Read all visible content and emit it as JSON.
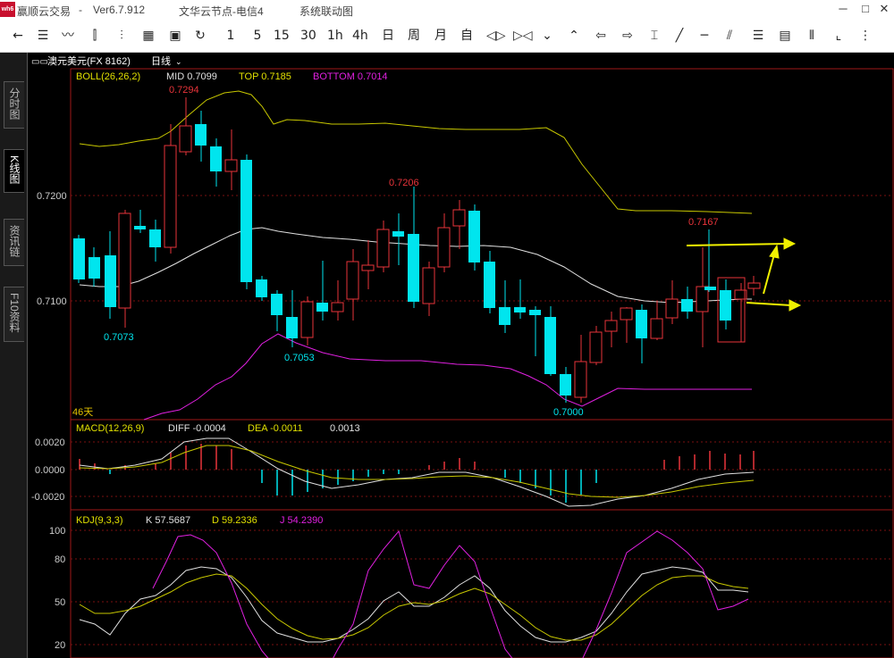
{
  "titlebar": {
    "app_name": "赢顺云交易",
    "separator": "-",
    "version": "Ver6.7.912",
    "node": "文华云节点-电信4",
    "sys": "系统联动图",
    "logo": "wh6"
  },
  "toolbar": {
    "periods": [
      "1",
      "5",
      "15",
      "30",
      "1h",
      "4h",
      "日",
      "周",
      "月",
      "自"
    ]
  },
  "sidetabs": [
    {
      "label": "分时图",
      "active": false
    },
    {
      "label": "K线图",
      "active": true
    },
    {
      "label": "资讯链",
      "active": false
    },
    {
      "label": "F10资料",
      "active": false
    }
  ],
  "header": {
    "menu_glyph": "▭▭",
    "symbol": "澳元美元(FX 8162)",
    "period": "日线"
  },
  "boll": {
    "name": "BOLL(26,26,2)",
    "mid": "MID 0.7099",
    "top": "TOP 0.7185",
    "bottom": "BOTTOM 0.7014"
  },
  "macd": {
    "name": "MACD(12,26,9)",
    "diff": "DIFF -0.0004",
    "dea": "DEA -0.0011",
    "macd": "0.0013"
  },
  "kdj": {
    "name": "KDJ(9,3,3)",
    "k": "K 57.5687",
    "d": "D 59.2336",
    "j": "J 54.2390"
  },
  "days_label": "46天",
  "price_axis": [
    "0.7200",
    "0.7100"
  ],
  "macd_axis": [
    "0.0020",
    "0.0000",
    "-0.0020"
  ],
  "kdj_axis": [
    "100",
    "80",
    "50",
    "20"
  ],
  "annotations": {
    "high1": "0.7294",
    "high2": "0.7206",
    "high3": "0.7167",
    "low1": "0.7073",
    "low2": "0.7053",
    "low3": "0.7000"
  },
  "colors": {
    "up": "#e8343a",
    "down": "#00e5ee",
    "boll_mid": "#e0e0e0",
    "boll_top": "#c8c800",
    "boll_bottom": "#e020e0",
    "arrow": "#f0f000"
  },
  "chart_data": {
    "type": "candlestick",
    "series": [
      {
        "name": "K",
        "values": [
          0.7158,
          0.7141,
          0.7093,
          0.7083,
          0.7145,
          0.7138,
          0.7213,
          0.7255,
          0.7257,
          0.7239,
          0.7223,
          0.7162,
          0.7118,
          0.7094,
          0.7074,
          0.7091,
          0.7093,
          0.7112,
          0.7139,
          0.7147,
          0.7168,
          0.7158,
          0.7116,
          0.7147,
          0.7182,
          0.7128,
          0.7085,
          0.7082,
          0.7079,
          0.704,
          0.7053,
          0.7047,
          0.7074,
          0.7089,
          0.7099,
          0.7081,
          0.7087,
          0.7088,
          0.7096,
          0.7114,
          0.711,
          0.7116,
          0.7114,
          0.7118
        ]
      }
    ]
  }
}
